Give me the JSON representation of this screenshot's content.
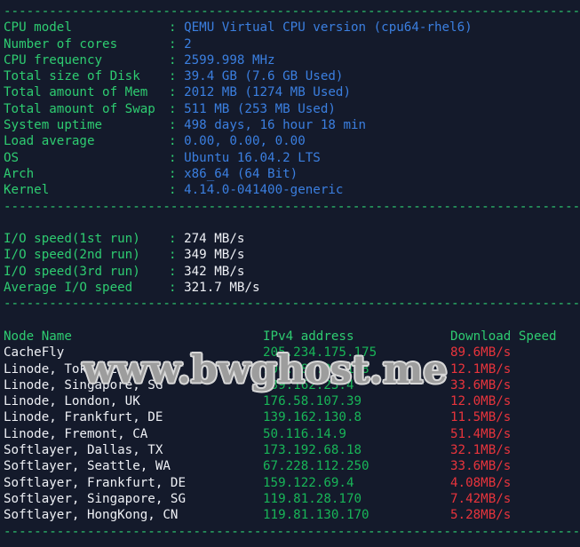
{
  "terminal": {
    "background_color": "#141a2b",
    "separator": "----------------------------------------------------------------------",
    "separator_color": "#2ecc71",
    "label_color": "#2ecc71",
    "value_color": "#3b7fe0",
    "io_value_color": "#eef0f5",
    "node_color": "#eef0f5",
    "ip_color": "#18b558",
    "speed_color": "#e8343c"
  },
  "watermark": {
    "text": "www.bwghost.me",
    "color": "#9d9d9d",
    "outline_color": "#d8d8d8"
  },
  "system_info": [
    {
      "label": "CPU model",
      "value": "QEMU Virtual CPU version (cpu64-rhel6)"
    },
    {
      "label": "Number of cores",
      "value": "2"
    },
    {
      "label": "CPU frequency",
      "value": "2599.998 MHz"
    },
    {
      "label": "Total size of Disk",
      "value": "39.4 GB (7.6 GB Used)"
    },
    {
      "label": "Total amount of Mem",
      "value": "2012 MB (1274 MB Used)"
    },
    {
      "label": "Total amount of Swap",
      "value": "511 MB (253 MB Used)"
    },
    {
      "label": "System uptime",
      "value": "498 days, 16 hour 18 min"
    },
    {
      "label": "Load average",
      "value": "0.00, 0.00, 0.00"
    },
    {
      "label": "OS",
      "value": "Ubuntu 16.04.2 LTS"
    },
    {
      "label": "Arch",
      "value": "x86_64 (64 Bit)"
    },
    {
      "label": "Kernel",
      "value": "4.14.0-041400-generic"
    }
  ],
  "io_tests": [
    {
      "label": "I/O speed(1st run)",
      "value": "274 MB/s"
    },
    {
      "label": "I/O speed(2nd run)",
      "value": "349 MB/s"
    },
    {
      "label": "I/O speed(3rd run)",
      "value": "342 MB/s"
    },
    {
      "label": "Average I/O speed",
      "value": "321.7 MB/s"
    }
  ],
  "network_table": {
    "headers": {
      "node": "Node Name",
      "ip": "IPv4 address",
      "speed": "Download Speed"
    },
    "rows": [
      {
        "node": "CacheFly",
        "ip": "205.234.175.175",
        "speed": "89.6MB/s"
      },
      {
        "node": "Linode, Tokyo 2, JP",
        "ip": "106.187.96.148",
        "speed": "12.1MB/s"
      },
      {
        "node": "Linode, Singapore, SG",
        "ip": "139.162.23.4",
        "speed": "33.6MB/s"
      },
      {
        "node": "Linode, London, UK",
        "ip": "176.58.107.39",
        "speed": "12.0MB/s"
      },
      {
        "node": "Linode, Frankfurt, DE",
        "ip": "139.162.130.8",
        "speed": "11.5MB/s"
      },
      {
        "node": "Linode, Fremont, CA",
        "ip": "50.116.14.9",
        "speed": "51.4MB/s"
      },
      {
        "node": "Softlayer, Dallas, TX",
        "ip": "173.192.68.18",
        "speed": "32.1MB/s"
      },
      {
        "node": "Softlayer, Seattle, WA",
        "ip": "67.228.112.250",
        "speed": "33.6MB/s"
      },
      {
        "node": "Softlayer, Frankfurt, DE",
        "ip": "159.122.69.4",
        "speed": "4.08MB/s"
      },
      {
        "node": "Softlayer, Singapore, SG",
        "ip": "119.81.28.170",
        "speed": "7.42MB/s"
      },
      {
        "node": "Softlayer, HongKong, CN",
        "ip": "119.81.130.170",
        "speed": "5.28MB/s"
      }
    ]
  }
}
